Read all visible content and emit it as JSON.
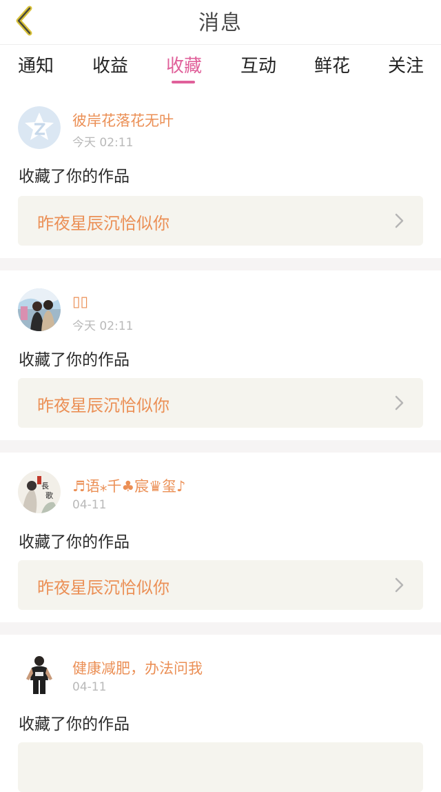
{
  "header": {
    "title": "消息"
  },
  "tabs": [
    {
      "label": "通知"
    },
    {
      "label": "收益"
    },
    {
      "label": "收藏"
    },
    {
      "label": "互动"
    },
    {
      "label": "鲜花"
    },
    {
      "label": "关注"
    }
  ],
  "active_tab": "收藏",
  "colors": {
    "accent": "#e0609a",
    "username": "#eb8f55",
    "card_bg": "#f5f4ee",
    "divider": "#f6f4f4",
    "back_arrow": "#d9c23a"
  },
  "messages": [
    {
      "username": "彼岸花落花无叶",
      "time": "今天 02:11",
      "action": "收藏了你的作品",
      "work_title": "昨夜星辰沉恰似你",
      "avatar_icon": "qzone-default-avatar-icon"
    },
    {
      "username": "▯▯",
      "time": "今天 02:11",
      "action": "收藏了你的作品",
      "work_title": "昨夜星辰沉恰似你",
      "avatar_icon": "couple-photo-avatar"
    },
    {
      "username": "♬语⁎千♣宸♛玺♪",
      "time": "04-11",
      "action": "收藏了你的作品",
      "work_title": "昨夜星辰沉恰似你",
      "avatar_icon": "illustration-avatar"
    },
    {
      "username": "健康减肥，办法问我",
      "time": "04-11",
      "action": "收藏了你的作品",
      "work_title": "",
      "avatar_icon": "man-standing-avatar"
    }
  ]
}
